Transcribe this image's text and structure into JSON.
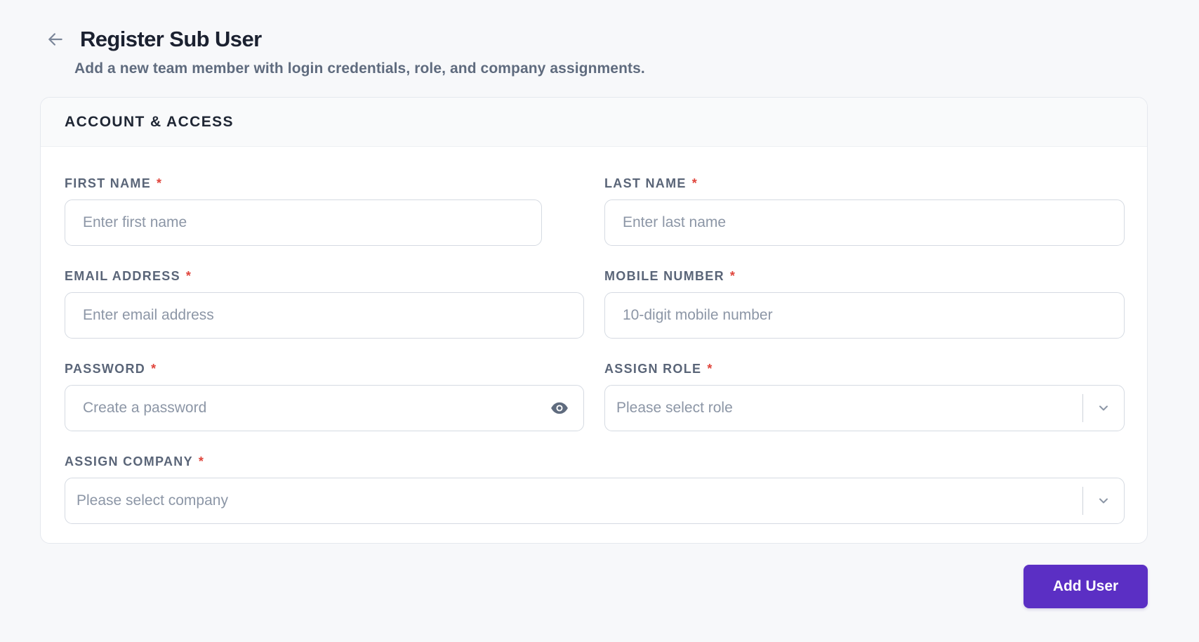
{
  "header": {
    "title": "Register Sub User",
    "subtitle": "Add a new team member with login credentials, role, and company assignments."
  },
  "card": {
    "title": "ACCOUNT & ACCESS"
  },
  "fields": {
    "first_name": {
      "label": "FIRST NAME",
      "required": "*",
      "placeholder": "Enter first name",
      "value": ""
    },
    "last_name": {
      "label": "LAST NAME",
      "required": "*",
      "placeholder": "Enter last name",
      "value": ""
    },
    "email": {
      "label": "EMAIL ADDRESS",
      "required": "*",
      "placeholder": "Enter email address",
      "value": ""
    },
    "mobile": {
      "label": "MOBILE NUMBER",
      "required": "*",
      "placeholder": "10-digit mobile number",
      "value": ""
    },
    "password": {
      "label": "PASSWORD",
      "required": "*",
      "placeholder": "Create a password",
      "value": ""
    },
    "role": {
      "label": "ASSIGN ROLE",
      "required": "*",
      "selected": "Please select role"
    },
    "company": {
      "label": "ASSIGN COMPANY",
      "required": "*",
      "selected": "Please select company"
    }
  },
  "icons": {
    "back": "arrow-left-icon",
    "password_toggle": "eye-icon",
    "dropdown": "chevron-down-icon"
  },
  "actions": {
    "submit_label": "Add User"
  },
  "colors": {
    "accent": "#5b2fc4",
    "required": "#e0453c",
    "background": "#f7f8fa"
  }
}
